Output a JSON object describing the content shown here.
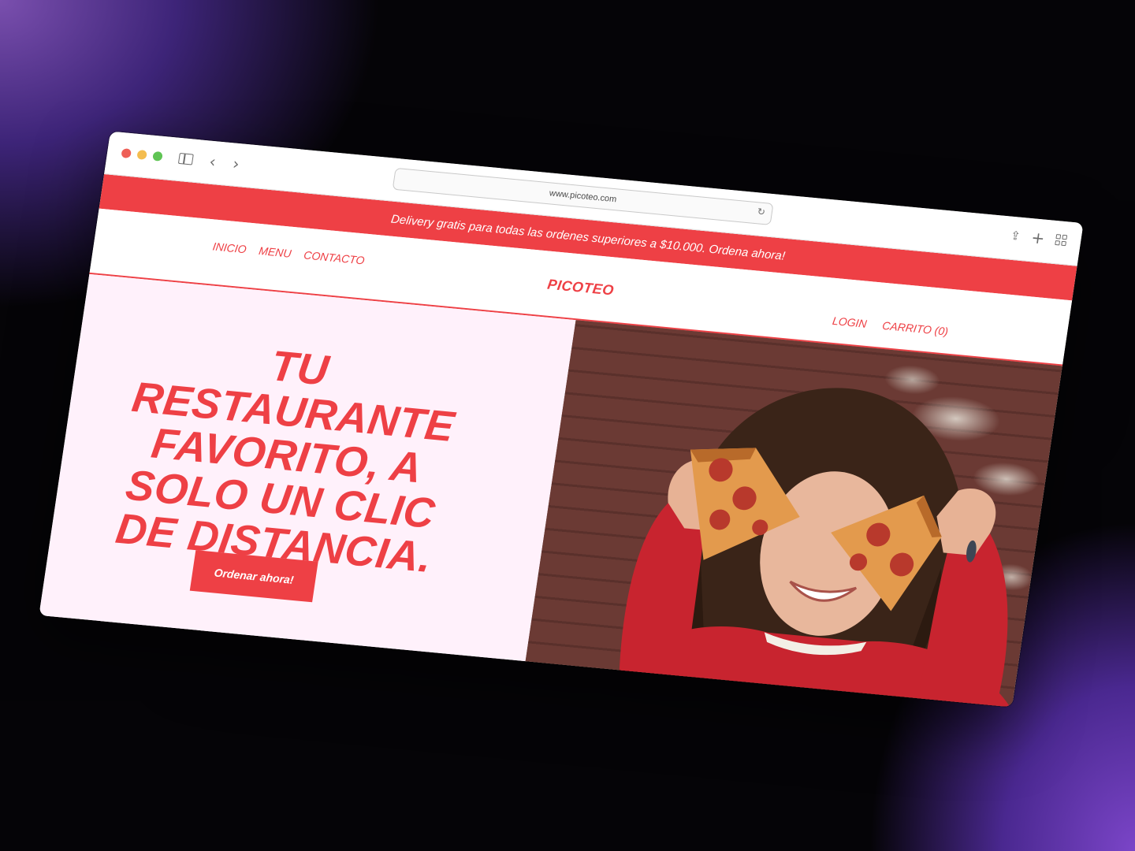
{
  "browser": {
    "url": "www.picoteo.com"
  },
  "promo": {
    "text": "Delivery gratis para todas las ordenes superiores a $10.000. Ordena ahora!"
  },
  "nav": {
    "left": [
      "INICIO",
      "MENU",
      "CONTACTO"
    ],
    "brand": "PICOTEO",
    "login": "LOGIN",
    "cart": "CARRITO (0)"
  },
  "hero": {
    "title": "TU RESTAURANTE FAVORITO, A SOLO UN CLIC DE DISTANCIA.",
    "cta": "Ordenar ahora!"
  },
  "colors": {
    "brand_red": "#ee4045",
    "hero_bg": "#fff1fb"
  },
  "icons": {
    "sidebar": "sidebar-icon",
    "back": "chevron-left-icon",
    "forward": "chevron-right-icon",
    "reload": "reload-icon",
    "share": "share-icon",
    "new_tab": "plus-icon",
    "tab_overview": "tabs-grid-icon"
  }
}
